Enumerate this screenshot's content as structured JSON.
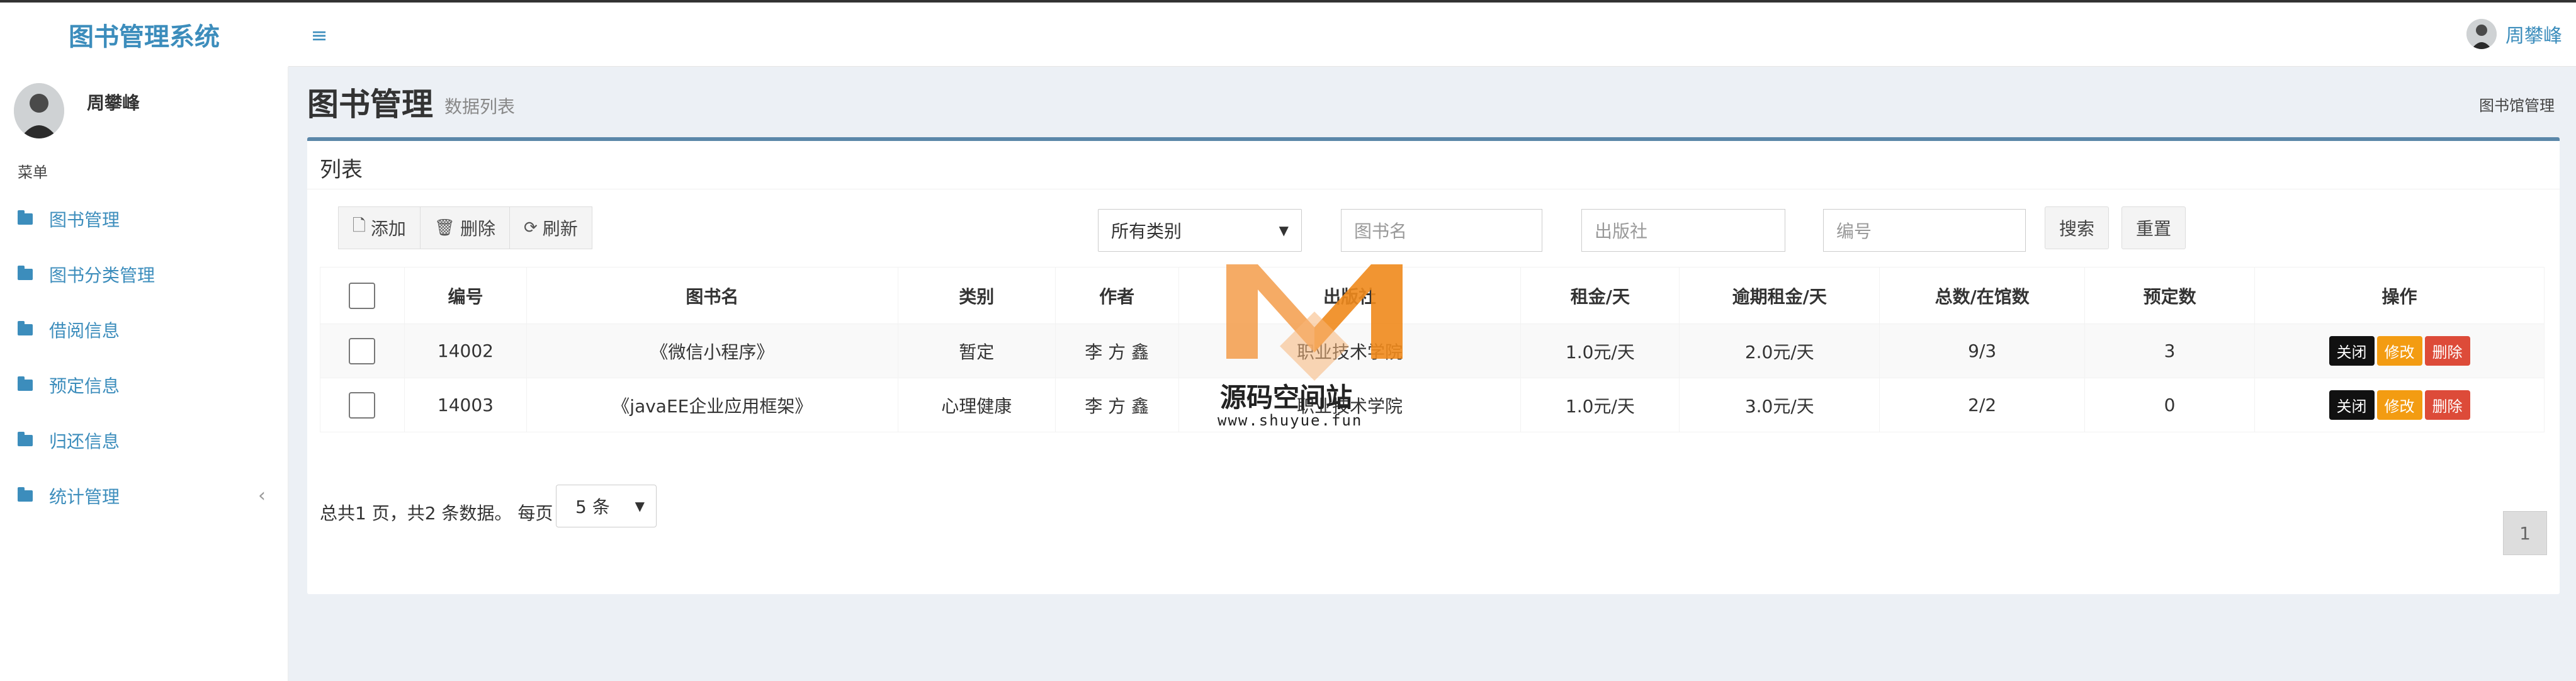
{
  "app": {
    "title": "图书管理系统"
  },
  "user": {
    "name": "周攀峰"
  },
  "sidebar": {
    "menu_header": "菜单",
    "items": [
      {
        "label": "图书管理"
      },
      {
        "label": "图书分类管理"
      },
      {
        "label": "借阅信息"
      },
      {
        "label": "预定信息"
      },
      {
        "label": "归还信息"
      },
      {
        "label": "统计管理"
      }
    ]
  },
  "content": {
    "title": "图书管理",
    "subtitle": "数据列表",
    "breadcrumb": "图书馆管理"
  },
  "box": {
    "title": "列表",
    "toolbar": {
      "add": "添加",
      "delete": "删除",
      "refresh": "刷新"
    },
    "filters": {
      "category_selected": "所有类别",
      "name_placeholder": "图书名",
      "publisher_placeholder": "出版社",
      "code_placeholder": "编号",
      "search": "搜索",
      "reset": "重置"
    }
  },
  "table": {
    "headers": [
      "编号",
      "图书名",
      "类别",
      "作者",
      "出版社",
      "租金/天",
      "逾期租金/天",
      "总数/在馆数",
      "预定数",
      "操作"
    ],
    "rows": [
      [
        "14002",
        "《微信小程序》",
        "暂定",
        "李 方 鑫",
        "职业技术学院",
        "1.0元/天",
        "2.0元/天",
        "9/3",
        "3"
      ],
      [
        "14003",
        "《javaEE企业应用框架》",
        "心理健康",
        "李 方 鑫",
        "职业技术学院",
        "1.0元/天",
        "3.0元/天",
        "2/2",
        "0"
      ]
    ],
    "ops": {
      "close": "关闭",
      "edit": "修改",
      "delete": "删除"
    }
  },
  "pagination": {
    "summary": "总共1 页，共2 条数据。 每页",
    "page_size": "5 条",
    "current_page": "1"
  },
  "watermark": {
    "name": "源码空间站",
    "url": "www.shuyue.fun"
  },
  "colors": {
    "accent": "#3c8dbc",
    "box_border": "#5b87a9",
    "close": "#111111",
    "edit": "#f39c12",
    "delete": "#dd4b39"
  }
}
